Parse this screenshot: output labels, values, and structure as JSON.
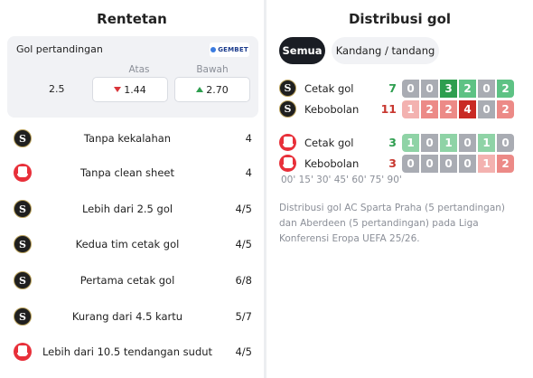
{
  "left": {
    "title": "Rentetan",
    "odds": {
      "title": "Gol pertandingan",
      "brand": "GEMBET",
      "over_label": "Atas",
      "under_label": "Bawah",
      "line": "2.5",
      "over_value": "1.44",
      "over_trend": "down",
      "under_value": "2.70",
      "under_trend": "up"
    },
    "streaks": [
      {
        "team": "sparta",
        "label": "Tanpa kekalahan",
        "value": "4"
      },
      {
        "team": "aberdeen",
        "label": "Tanpa clean sheet",
        "value": "4"
      },
      {
        "team": "sparta",
        "label": "Lebih dari 2.5 gol",
        "value": "4/5"
      },
      {
        "team": "sparta",
        "label": "Kedua tim cetak gol",
        "value": "4/5"
      },
      {
        "team": "sparta",
        "label": "Pertama cetak gol",
        "value": "6/8"
      },
      {
        "team": "sparta",
        "label": "Kurang dari 4.5 kartu",
        "value": "5/7"
      },
      {
        "team": "aberdeen",
        "label": "Lebih dari 10.5 tendangan sudut",
        "value": "4/5"
      }
    ]
  },
  "right": {
    "title": "Distribusi gol",
    "tabs": [
      {
        "label": "Semua",
        "active": true
      },
      {
        "label": "Kandang / tandang",
        "active": false
      }
    ],
    "groups": [
      {
        "team": "sparta",
        "rows": [
          {
            "label": "Cetak gol",
            "total": "7",
            "total_color": "#2e9e4f",
            "kind": "scored",
            "values": [
              0,
              0,
              3,
              2,
              0,
              2
            ]
          },
          {
            "label": "Kebobolan",
            "total": "11",
            "total_color": "#c8372f",
            "kind": "conceded",
            "values": [
              1,
              2,
              2,
              4,
              0,
              2
            ]
          }
        ]
      },
      {
        "team": "aberdeen",
        "rows": [
          {
            "label": "Cetak gol",
            "total": "3",
            "total_color": "#2e9e4f",
            "kind": "scored",
            "values": [
              1,
              0,
              1,
              0,
              1,
              0
            ]
          },
          {
            "label": "Kebobolan",
            "total": "3",
            "total_color": "#c8372f",
            "kind": "conceded",
            "values": [
              0,
              0,
              0,
              0,
              1,
              2
            ]
          }
        ]
      }
    ],
    "time_ticks": "00' 15' 30' 45' 60' 75' 90'",
    "description": "Distribusi gol AC Sparta Praha (5 pertandingan) dan Aberdeen (5 pertandingan) pada Liga Konferensi Eropa UEFA 25/26."
  }
}
